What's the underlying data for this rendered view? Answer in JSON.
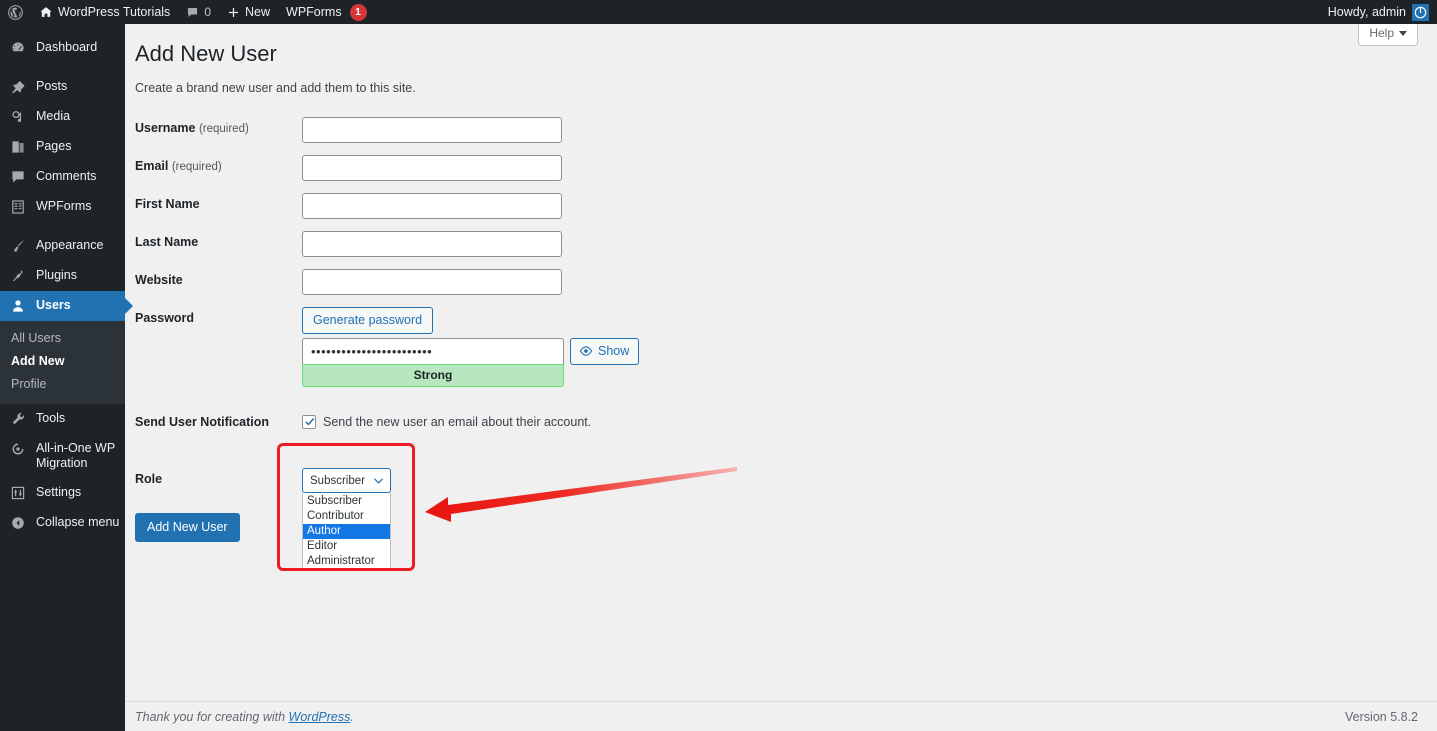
{
  "adminbar": {
    "logo_icon": "wordpress-logo-icon",
    "site_name": "WordPress Tutorials",
    "home_icon": "home-icon",
    "comments_icon": "comment-bubble-icon",
    "comments_count": "0",
    "new_icon": "plus-icon",
    "new_label": "New",
    "wpforms_label": "WPForms",
    "wpforms_badge": "1",
    "howdy": "Howdy, admin",
    "avatar_icon": "user-avatar-icon",
    "avatar_color": "#2271b1"
  },
  "sidebar": {
    "items": [
      {
        "label": "Dashboard",
        "icon": "dashboard-icon",
        "current": false
      },
      {
        "label": "Posts",
        "icon": "pin-icon",
        "current": false
      },
      {
        "label": "Media",
        "icon": "media-icon",
        "current": false
      },
      {
        "label": "Pages",
        "icon": "pages-icon",
        "current": false
      },
      {
        "label": "Comments",
        "icon": "comment-bubble-icon",
        "current": false
      },
      {
        "label": "WPForms",
        "icon": "form-icon",
        "current": false
      },
      {
        "label": "Appearance",
        "icon": "paintbrush-icon",
        "current": false
      },
      {
        "label": "Plugins",
        "icon": "plugin-icon",
        "current": false
      },
      {
        "label": "Users",
        "icon": "user-icon",
        "current": true
      },
      {
        "label": "Tools",
        "icon": "wrench-icon",
        "current": false
      },
      {
        "label": "All-in-One WP Migration",
        "icon": "migration-icon",
        "current": false
      },
      {
        "label": "Settings",
        "icon": "settings-sliders-icon",
        "current": false
      },
      {
        "label": "Collapse menu",
        "icon": "collapse-arrow-icon",
        "current": false
      }
    ],
    "submenu": [
      {
        "label": "All Users",
        "current": false
      },
      {
        "label": "Add New",
        "current": true
      },
      {
        "label": "Profile",
        "current": false
      }
    ]
  },
  "content": {
    "help_tab": "Help",
    "page_title": "Add New User",
    "page_description": "Create a brand new user and add them to this site.",
    "fields": {
      "username_label": "Username",
      "username_required": "(required)",
      "username_value": "",
      "email_label": "Email",
      "email_required": "(required)",
      "email_value": "",
      "first_name_label": "First Name",
      "first_name_value": "",
      "last_name_label": "Last Name",
      "last_name_value": "",
      "website_label": "Website",
      "website_value": "",
      "password_label": "Password",
      "generate_password_label": "Generate password",
      "password_value": "••••••••••••••••••••••••",
      "password_strength": "Strong",
      "show_password_label": "Show",
      "show_password_icon": "eye-icon",
      "notification_label": "Send User Notification",
      "notification_checkbox_label": "Send the new user an email about their account.",
      "notification_checked": true,
      "role_label": "Role"
    },
    "role": {
      "selected": "Subscriber",
      "chevron_icon": "chevron-down-icon",
      "options": [
        {
          "label": "Subscriber",
          "highlighted": false
        },
        {
          "label": "Contributor",
          "highlighted": false
        },
        {
          "label": "Author",
          "highlighted": true
        },
        {
          "label": "Editor",
          "highlighted": false
        },
        {
          "label": "Administrator",
          "highlighted": false
        }
      ],
      "highlight_color": "#1477e6",
      "annotation_box_color": "#ed1c24",
      "annotation_arrow": "red-left-arrow"
    },
    "submit_label": "Add New User"
  },
  "footer": {
    "thanks_prefix": "Thank you for creating with ",
    "wordpress_link": "WordPress",
    "thanks_suffix": ".",
    "version": "Version 5.8.2"
  }
}
